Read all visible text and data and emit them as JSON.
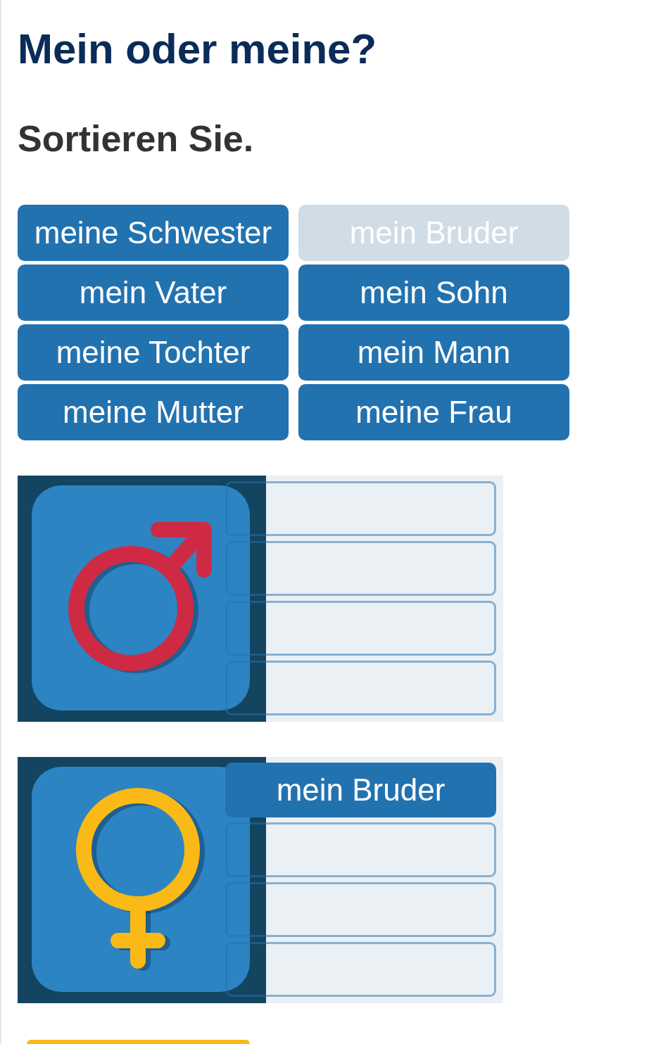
{
  "title": "Mein oder meine?",
  "instruction": "Sortieren Sie.",
  "words": [
    {
      "label": "meine Schwester",
      "used": false
    },
    {
      "label": "mein Bruder",
      "used": true
    },
    {
      "label": "mein Vater",
      "used": false
    },
    {
      "label": "mein Sohn",
      "used": false
    },
    {
      "label": "meine Tochter",
      "used": false
    },
    {
      "label": "mein Mann",
      "used": false
    },
    {
      "label": "meine Mutter",
      "used": false
    },
    {
      "label": "meine Frau",
      "used": false
    }
  ],
  "categories": [
    {
      "kind": "male",
      "color": "#cf2a44",
      "slots": [
        {
          "kind": "empty"
        },
        {
          "kind": "empty"
        },
        {
          "kind": "empty"
        },
        {
          "kind": "empty"
        }
      ]
    },
    {
      "kind": "female",
      "color": "#f9b916",
      "slots": [
        {
          "kind": "filled",
          "label": "mein Bruder"
        },
        {
          "kind": "empty"
        },
        {
          "kind": "empty"
        },
        {
          "kind": "empty"
        }
      ]
    }
  ]
}
